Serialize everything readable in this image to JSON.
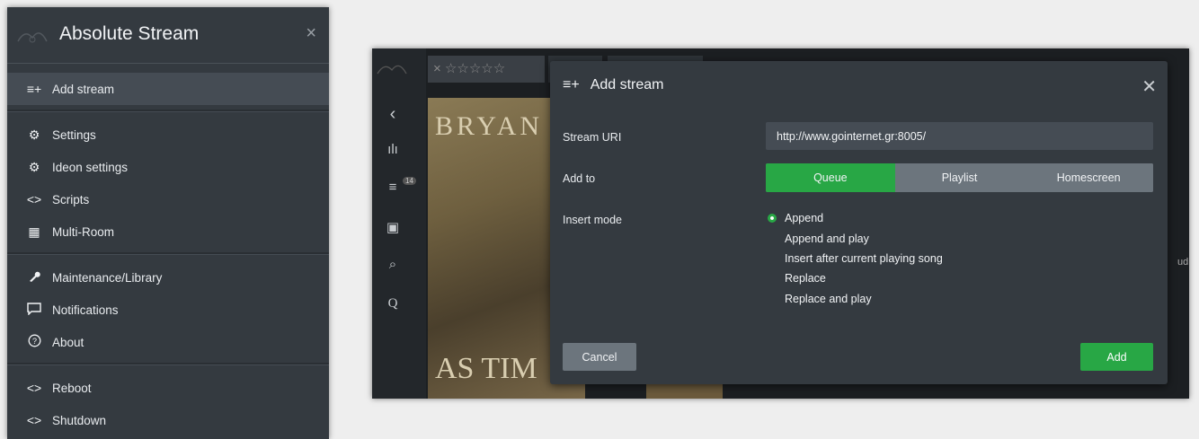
{
  "menu": {
    "title": "Absolute Stream",
    "logo_icon": "moode-logo-icon",
    "close_icon": "close-icon",
    "items": [
      {
        "label": "Add stream",
        "icon": "add-list-icon",
        "glyph": "≡+"
      },
      {
        "label": "Settings",
        "icon": "gear-icon",
        "glyph": "⚙"
      },
      {
        "label": "Ideon settings",
        "icon": "gear-icon",
        "glyph": "⚙"
      },
      {
        "label": "Scripts",
        "icon": "code-icon",
        "glyph": "<>"
      },
      {
        "label": "Multi-Room",
        "icon": "grid-icon",
        "glyph": "▦"
      },
      {
        "label": "Maintenance/Library",
        "icon": "wrench-icon",
        "glyph": "🔧"
      },
      {
        "label": "Notifications",
        "icon": "message-icon",
        "glyph": "▭"
      },
      {
        "label": "About",
        "icon": "question-icon",
        "glyph": "?"
      },
      {
        "label": "Reboot",
        "icon": "code-icon",
        "glyph": "<>"
      },
      {
        "label": "Shutdown",
        "icon": "code-icon",
        "glyph": "<>"
      }
    ]
  },
  "app": {
    "stars": "× ☆☆☆☆☆",
    "cover_text_top": "BRYAN",
    "cover_text_bottom": "AS TIM",
    "side_glyphs": [
      "‹",
      "ılı",
      "≡",
      "▣",
      "⌕",
      "Q"
    ],
    "badge": "14",
    "right_edge_text": "udio"
  },
  "modal": {
    "title": "Add stream",
    "title_icon": "add-list-icon",
    "close_icon": "close-icon",
    "stream_uri_label": "Stream URI",
    "stream_uri_value": "http://www.gointernet.gr:8005/",
    "add_to_label": "Add to",
    "add_to_options": [
      "Queue",
      "Playlist",
      "Homescreen"
    ],
    "add_to_selected": "Queue",
    "insert_mode_label": "Insert mode",
    "insert_modes": [
      "Append",
      "Append and play",
      "Insert after current playing song",
      "Replace",
      "Replace and play"
    ],
    "insert_mode_selected": "Append",
    "cancel_label": "Cancel",
    "add_label": "Add"
  },
  "colors": {
    "accent": "#28a745",
    "panel": "#343a40",
    "secondary": "#6c757d"
  }
}
